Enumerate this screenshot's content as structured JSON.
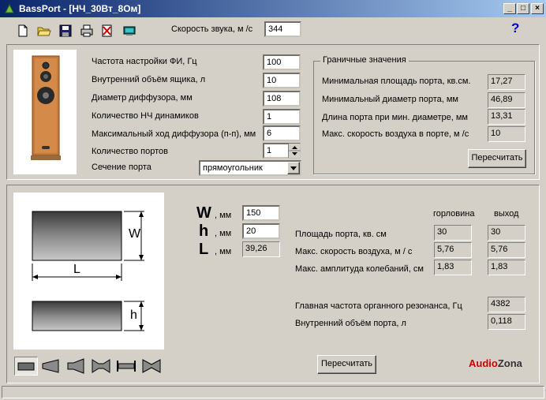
{
  "window": {
    "title": "BassPort - [НЧ_30Вт_8Ом]",
    "min": "_",
    "max": "□",
    "close": "×"
  },
  "toolbar": {
    "icons": [
      "new-file-icon",
      "open-folder-icon",
      "save-disk-icon",
      "print-icon",
      "delete-icon",
      "monitor-icon"
    ],
    "speed_label": "Скорость звука, м /с",
    "speed_value": "344",
    "help": "?"
  },
  "params": {
    "freq": {
      "label": "Частота настройки ФИ, Гц",
      "value": "100"
    },
    "volume": {
      "label": "Внутренний объём ящика, л",
      "value": "10"
    },
    "diameter": {
      "label": "Диаметр диффузора, мм",
      "value": "108"
    },
    "drivers": {
      "label": "Количество НЧ динамиков",
      "value": "1"
    },
    "xmax": {
      "label": "Максимальный ход диффузора (п-п), мм",
      "value": "6"
    },
    "ports": {
      "label": "Количество портов",
      "value": "1"
    },
    "section": {
      "label": "Сечение порта",
      "value": "прямоугольник"
    }
  },
  "limits": {
    "title": "Граничные значения",
    "min_area": {
      "label": "Минимальная площадь порта, кв.см.",
      "value": "17,27"
    },
    "min_diam": {
      "label": "Минимальный диаметр порта, мм",
      "value": "46,89"
    },
    "port_len": {
      "label": "Длина порта при мин. диаметре, мм",
      "value": "13,31"
    },
    "max_speed": {
      "label": "Макс. скорость воздуха в порте, м /с",
      "value": "10"
    },
    "recalc": "Пересчитать"
  },
  "diagram": {
    "w_label": "W",
    "l_label": "L",
    "h_label": "h"
  },
  "dims": {
    "W": {
      "letter": "W",
      "unit": ", мм",
      "value": "150"
    },
    "h": {
      "letter": "h",
      "unit": ", мм",
      "value": "20"
    },
    "L": {
      "letter": "L",
      "unit": ", мм",
      "value": "39,26"
    }
  },
  "results": {
    "col_throat": "горловина",
    "col_exit": "выход",
    "area": {
      "label": "Площадь порта, кв. см",
      "throat": "30",
      "exit": "30"
    },
    "speed": {
      "label": "Макс. скорость воздуха, м / с",
      "throat": "5,76",
      "exit": "5,76"
    },
    "amplitude": {
      "label": "Макс. амплитуда колебаний, см",
      "throat": "1,83",
      "exit": "1,83"
    },
    "resonance": {
      "label": "Главная частота органного резонанса, Гц",
      "value": "4382"
    },
    "port_volume": {
      "label": "Внутренний объём порта, л",
      "value": "0,118"
    }
  },
  "bottom": {
    "recalc": "Пересчитать",
    "logo_a": "Audio",
    "logo_b": "Zona"
  },
  "colors": {
    "title_start": "#0a246a",
    "title_end": "#a6caf0",
    "logo_red": "#cc0000",
    "help_blue": "#0000cc"
  }
}
